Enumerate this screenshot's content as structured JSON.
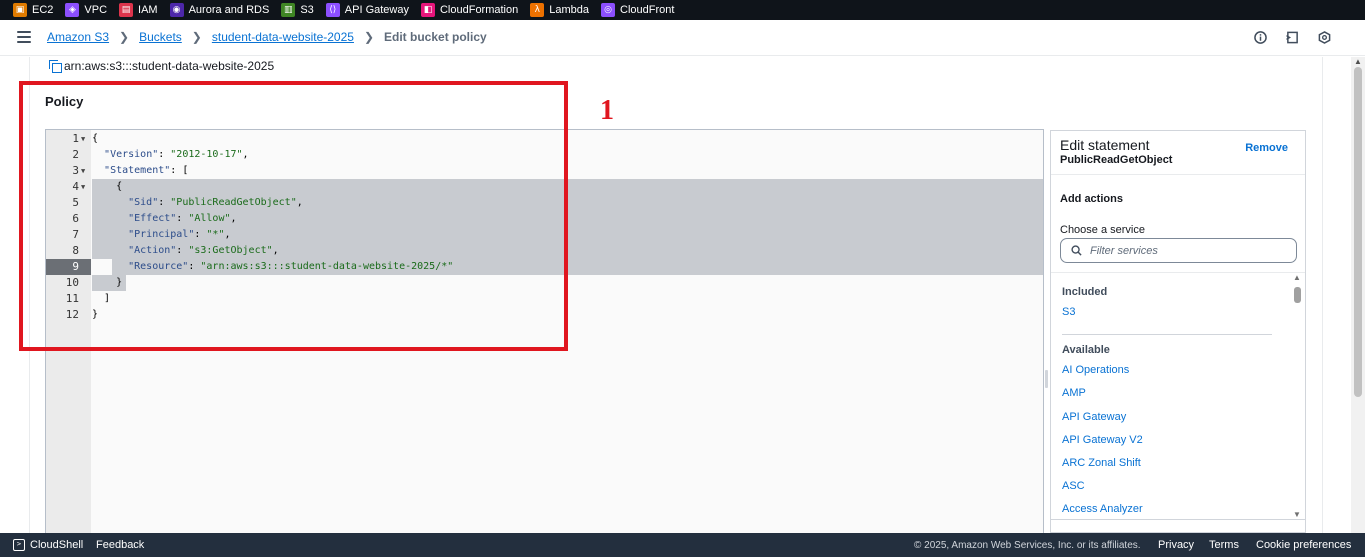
{
  "favorites": [
    {
      "label": "EC2",
      "icon": "ec2-icon",
      "color": "#e07b00"
    },
    {
      "label": "VPC",
      "icon": "vpc-icon",
      "color": "#8c4fff"
    },
    {
      "label": "IAM",
      "icon": "iam-icon",
      "color": "#dd344c"
    },
    {
      "label": "Aurora and RDS",
      "icon": "rds-icon",
      "color": "#4d27aa"
    },
    {
      "label": "S3",
      "icon": "s3-icon",
      "color": "#3f8624"
    },
    {
      "label": "API Gateway",
      "icon": "api-gateway-icon",
      "color": "#8c4fff"
    },
    {
      "label": "CloudFormation",
      "icon": "cloudformation-icon",
      "color": "#e7157b"
    },
    {
      "label": "Lambda",
      "icon": "lambda-icon",
      "color": "#ed7100"
    },
    {
      "label": "CloudFront",
      "icon": "cloudfront-icon",
      "color": "#8c4fff"
    }
  ],
  "breadcrumb": {
    "items": [
      "Amazon S3",
      "Buckets",
      "student-data-website-2025"
    ],
    "current": "Edit bucket policy"
  },
  "arn": "arn:aws:s3:::student-data-website-2025",
  "policy": {
    "title": "Policy",
    "annotation": "1",
    "lines": [
      {
        "n": "1",
        "fold": true
      },
      {
        "n": "2",
        "fold": false
      },
      {
        "n": "3",
        "fold": true
      },
      {
        "n": "4",
        "fold": true
      },
      {
        "n": "5",
        "fold": false
      },
      {
        "n": "6",
        "fold": false
      },
      {
        "n": "7",
        "fold": false
      },
      {
        "n": "8",
        "fold": false
      },
      {
        "n": "9",
        "fold": false
      },
      {
        "n": "10",
        "fold": false
      },
      {
        "n": "11",
        "fold": false
      },
      {
        "n": "12",
        "fold": false
      }
    ],
    "code": {
      "l1": "{",
      "l2_key": "\"Version\"",
      "l2_val": "\"2012-10-17\"",
      "l3_key": "\"Statement\"",
      "l3_rest": ": [",
      "l4": "{",
      "l5_key": "\"Sid\"",
      "l5_val": "\"PublicReadGetObject\"",
      "l6_key": "\"Effect\"",
      "l6_val": "\"Allow\"",
      "l7_key": "\"Principal\"",
      "l7_val": "\"*\"",
      "l8_key": "\"Action\"",
      "l8_val": "\"s3:GetObject\"",
      "l9_key": "\"Resource\"",
      "l9_val": "\"arn:aws:s3:::student-data-website-2025/*\"",
      "l10": "}",
      "l11": "]",
      "l12": "}"
    }
  },
  "side_panel": {
    "title": "Edit statement",
    "subtitle": "PublicReadGetObject",
    "remove_label": "Remove",
    "add_actions": "Add actions",
    "choose_service": "Choose a service",
    "filter_placeholder": "Filter services",
    "included_heading": "Included",
    "included": [
      "S3"
    ],
    "available_heading": "Available",
    "available": [
      "AI Operations",
      "AMP",
      "API Gateway",
      "API Gateway V2",
      "ARC Zonal Shift",
      "ASC",
      "Access Analyzer"
    ]
  },
  "footer": {
    "cloudshell": "CloudShell",
    "feedback": "Feedback",
    "copyright": "© 2025, Amazon Web Services, Inc. or its affiliates.",
    "privacy": "Privacy",
    "terms": "Terms",
    "cookies": "Cookie preferences"
  }
}
